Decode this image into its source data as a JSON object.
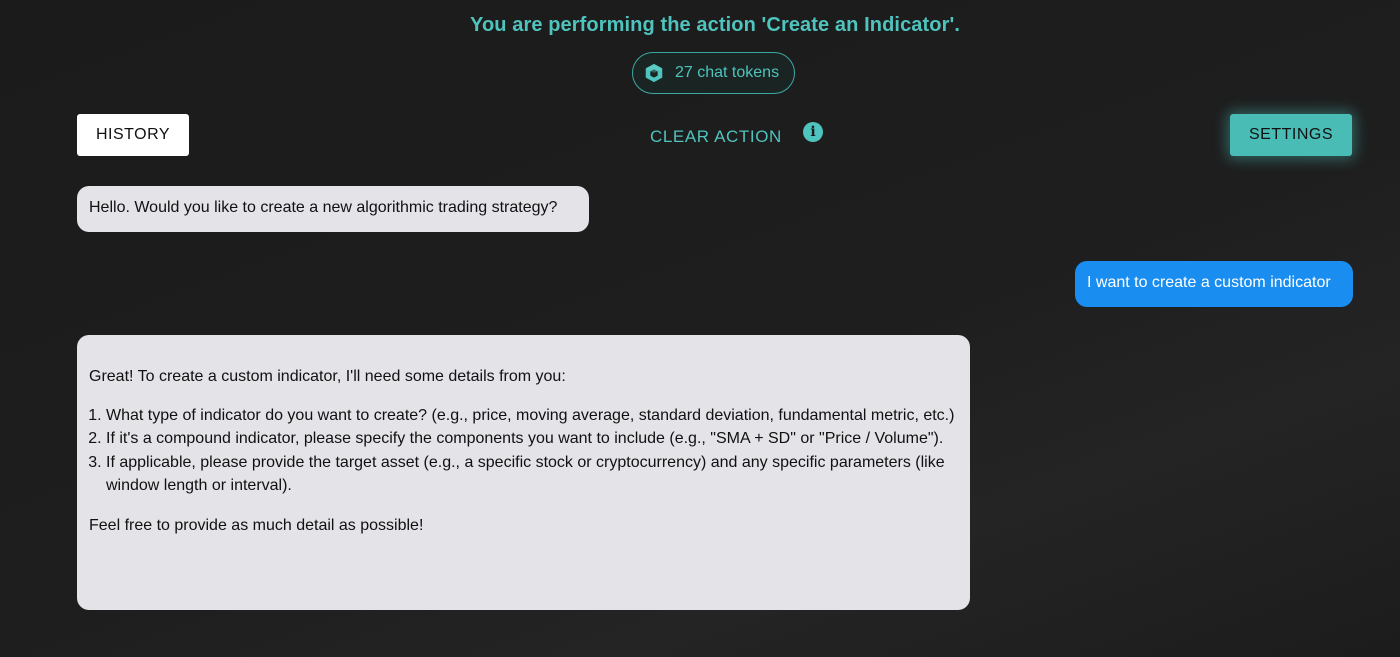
{
  "header": {
    "action_title": "You are performing the action 'Create an Indicator'.",
    "tokens_label": "27 chat tokens",
    "tokens_icon": "cube-icon"
  },
  "toolbar": {
    "history_label": "HISTORY",
    "clear_action_label": "CLEAR ACTION",
    "info_icon": "info-icon",
    "settings_label": "SETTINGS"
  },
  "colors": {
    "accent": "#4fc3bd",
    "user_bubble": "#1a8df0",
    "bot_bubble": "#e3e3e8",
    "background": "#1b1b1b"
  },
  "messages": [
    {
      "role": "assistant",
      "text": "Hello. Would you like to create a new algorithmic trading strategy?"
    },
    {
      "role": "user",
      "text": "I want to create a custom indicator"
    },
    {
      "role": "assistant",
      "intro": "Great! To create a custom indicator, I'll need some details from you:",
      "items": [
        "What type of indicator do you want to create? (e.g., price, moving average, standard deviation, fundamental metric, etc.)",
        "If it's a compound indicator, please specify the components you want to include (e.g., \"SMA + SD\" or \"Price / Volume\").",
        "If applicable, please provide the target asset (e.g., a specific stock or cryptocurrency) and any specific parameters (like window length or interval)."
      ],
      "outro": "Feel free to provide as much detail as possible!"
    }
  ]
}
